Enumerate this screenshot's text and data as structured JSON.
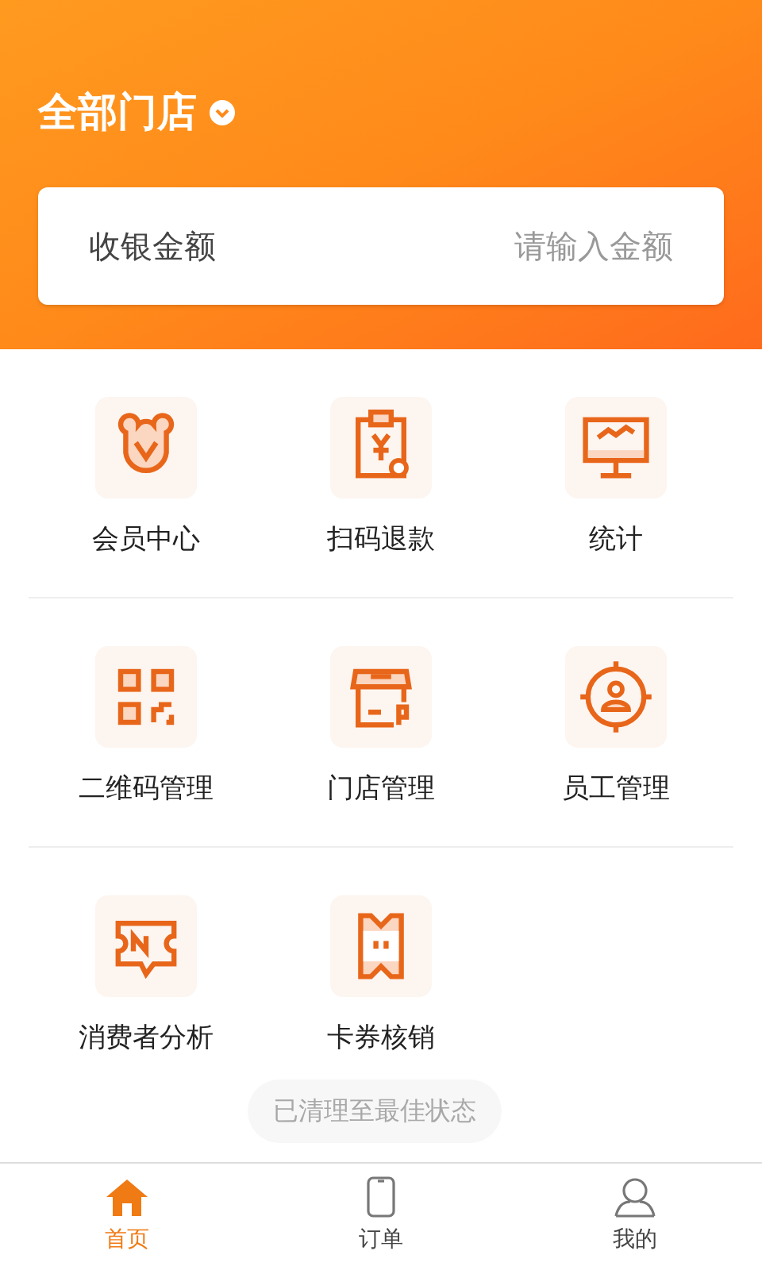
{
  "header": {
    "store_selector": "全部门店"
  },
  "amount_field": {
    "label": "收银金额",
    "placeholder": "请输入金额"
  },
  "features": [
    {
      "label": "会员中心"
    },
    {
      "label": "扫码退款"
    },
    {
      "label": "统计"
    },
    {
      "label": "二维码管理"
    },
    {
      "label": "门店管理"
    },
    {
      "label": "员工管理"
    },
    {
      "label": "消费者分析"
    },
    {
      "label": "卡券核销"
    }
  ],
  "toast": "已清理至最佳状态",
  "tab_bar": [
    {
      "label": "首页",
      "selected": true
    },
    {
      "label": "订单",
      "selected": false
    },
    {
      "label": "我的",
      "selected": false
    }
  ]
}
